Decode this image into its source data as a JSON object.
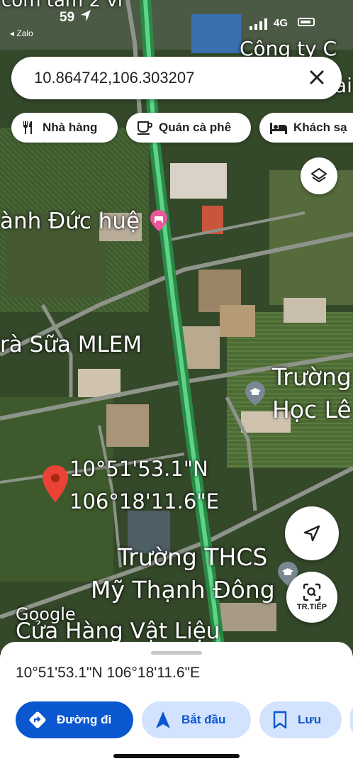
{
  "status_bar": {
    "time": "59",
    "back_app": "◂ Zalo",
    "network": "4G"
  },
  "search": {
    "query": "10.864742,106.303207"
  },
  "chips": [
    {
      "label": "Nhà hàng",
      "icon": "restaurant-icon"
    },
    {
      "label": "Quán cà phê",
      "icon": "coffee-icon"
    },
    {
      "label": "Khách sạ",
      "icon": "hotel-icon"
    }
  ],
  "map_labels": {
    "top_left": "cơm tấm 2 vi",
    "company": "Công ty C",
    "company_2": "ai",
    "hotel": "ành Đức huệ",
    "tea": "rà Sữa MLEM",
    "school_1_line1": "Trường",
    "school_1_line2": "Học Lê",
    "pin_lat": "10°51'53.1\"N",
    "pin_lng": "106°18'11.6\"E",
    "school_2_line1": "Trường THCS",
    "school_2_line2": "Mỹ Thạnh Đông",
    "store": "Cửa Hàng Vật Liệu",
    "google": "Google"
  },
  "map_buttons": {
    "layers": "layers-icon",
    "location": "my-location-icon",
    "lens_label": "TR.TIẾP"
  },
  "sheet": {
    "coords": "10°51'53.1\"N 106°18'11.6\"E",
    "directions_label": "Đường đi",
    "start_label": "Bắt đầu",
    "save_label": "Lưu"
  },
  "colors": {
    "primary": "#0b57d0",
    "tonal": "#d3e3fd",
    "pin": "#ea4335",
    "road_highlight": "#34a853"
  }
}
